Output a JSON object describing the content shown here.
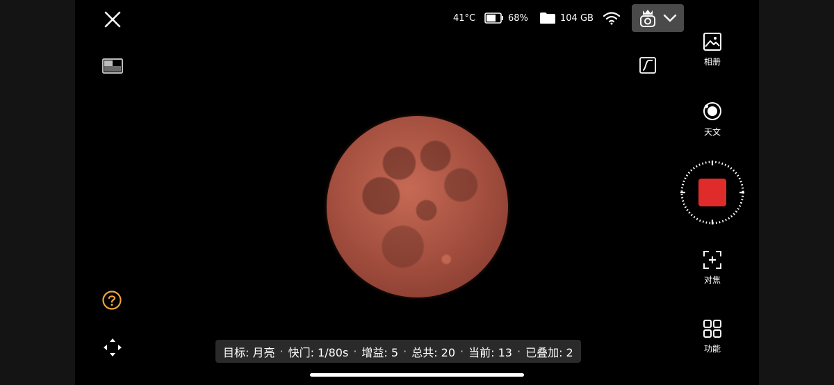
{
  "status": {
    "temperature": "41°C",
    "battery": "68%",
    "storage": "104 GB"
  },
  "right_panel": {
    "album_label": "相册",
    "astro_label": "天文",
    "focus_label": "对焦",
    "function_label": "功能"
  },
  "recording": {
    "state": "recording"
  },
  "info_bar": {
    "target": "目标: 月亮",
    "shutter": "快门: 1/80s",
    "gain": "增益: 5",
    "total": "总共: 20",
    "current": "当前: 13",
    "stacked": "已叠加: 2",
    "separator": "·"
  },
  "colors": {
    "record_button": "#e02b2b",
    "help_icon": "#f0a33a",
    "device_button_bg": "#4a4a4a"
  }
}
